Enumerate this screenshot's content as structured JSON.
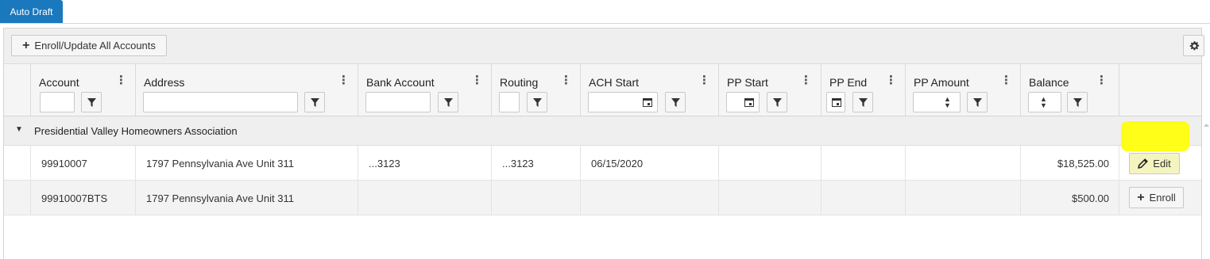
{
  "tab": {
    "label": "Auto Draft"
  },
  "toolbar": {
    "enroll_all_label": "Enroll/Update All Accounts"
  },
  "columns": [
    {
      "key": "account",
      "label": "Account"
    },
    {
      "key": "address",
      "label": "Address"
    },
    {
      "key": "bank_account",
      "label": "Bank Account"
    },
    {
      "key": "routing",
      "label": "Routing"
    },
    {
      "key": "ach_start",
      "label": "ACH Start"
    },
    {
      "key": "pp_start",
      "label": "PP Start"
    },
    {
      "key": "pp_end",
      "label": "PP End"
    },
    {
      "key": "pp_amount",
      "label": "PP Amount"
    },
    {
      "key": "balance",
      "label": "Balance"
    }
  ],
  "group": {
    "name": "Presidential Valley Homeowners Association"
  },
  "rows": [
    {
      "account": "99910007",
      "address": "1797 Pennsylvania Ave Unit 311",
      "bank_account": "...3123",
      "routing": "...3123",
      "ach_start": "06/15/2020",
      "pp_start": "",
      "pp_end": "",
      "pp_amount": "",
      "balance": "$18,525.00",
      "action": "Edit"
    },
    {
      "account": "99910007BTS",
      "address": "1797 Pennsylvania Ave Unit 311",
      "bank_account": "",
      "routing": "",
      "ach_start": "",
      "pp_start": "",
      "pp_end": "",
      "pp_amount": "",
      "balance": "$500.00",
      "action": "Enroll"
    }
  ],
  "icons": {
    "gear": "gear-icon",
    "filter": "filter-icon",
    "calendar": "calendar-icon",
    "column_menu": "vertical-dots-icon",
    "expand": "caret-down-icon",
    "pencil": "pencil-icon",
    "plus": "plus-icon",
    "spinner": "spinner-icon"
  },
  "colors": {
    "tab": "#1a78bd",
    "highlight": "#ffff00"
  }
}
